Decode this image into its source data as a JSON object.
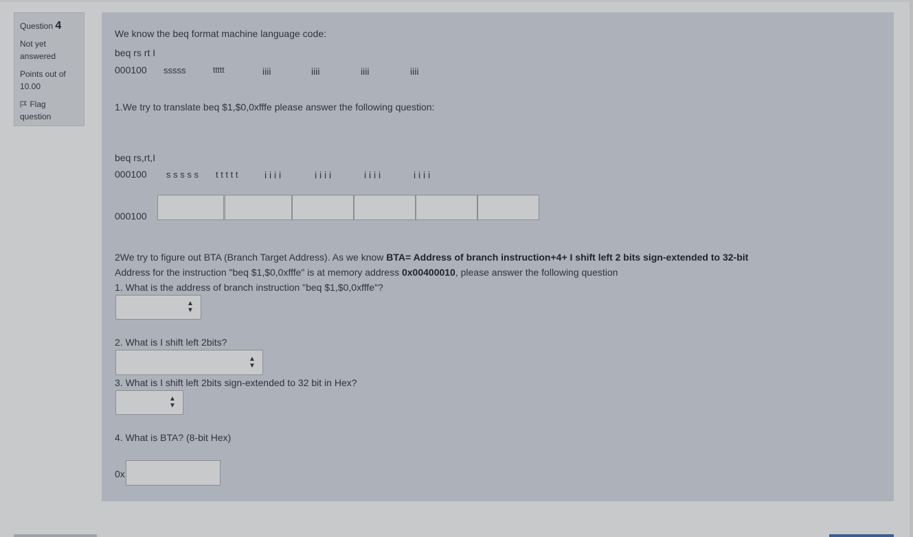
{
  "info": {
    "question_label": "Question",
    "question_number": "4",
    "state": "Not yet answered",
    "grade": "Points out of 10.00",
    "flag_label": "Flag question"
  },
  "content": {
    "intro": "We know the beq format machine language code:",
    "format_label": "beq rs rt I",
    "format_row": [
      "000100",
      "sssss",
      "ttttt",
      "iiii",
      "iiii",
      "iiii",
      "iiii"
    ],
    "q1_text": "1.We try to translate beq $1,$0,0xfffe please answer the following question:",
    "format_label2": "beq rs,rt,I",
    "format_row2": [
      "000100",
      "s s s s s",
      "t t t t t",
      "i i i i",
      "i i i i",
      "i i i i",
      "i i i i"
    ],
    "answer_prefix": "000100",
    "q2_line1_a": "2We try to figure out BTA (Branch Target Address). As we know ",
    "q2_line1_b": "BTA= Address of branch instruction+4+ I shift  left 2 bits sign-extended to 32-bit",
    "q2_line2_a": "Address for the instruction \"beq $1,$0,0xfffe\" is at memory address ",
    "q2_line2_b": "0x00400010",
    "q2_line2_c": ", please answer the following question",
    "sub1": "1. What is the address of branch instruction \"beq $1,$0,0xfffe\"?",
    "sub2": "2. What is I shift left 2bits?",
    "sub3": "3. What is I shift left 2bits sign-extended to 32 bit in Hex?",
    "sub4": "4. What is BTA? (8-bit Hex)",
    "hex_prefix": "0x"
  }
}
